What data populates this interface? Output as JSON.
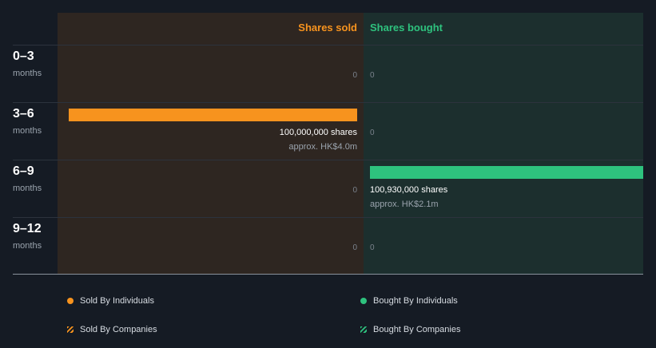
{
  "chart_data": {
    "type": "bar",
    "orientation": "horizontal",
    "columns": [
      "Shares sold",
      "Shares bought"
    ],
    "categories": [
      {
        "range": "0–3",
        "unit": "months"
      },
      {
        "range": "3–6",
        "unit": "months"
      },
      {
        "range": "6–9",
        "unit": "months"
      },
      {
        "range": "9–12",
        "unit": "months"
      }
    ],
    "series": [
      {
        "name": "Shares sold",
        "color": "#f7931e",
        "values": [
          0,
          100000000,
          0,
          0
        ]
      },
      {
        "name": "Shares bought",
        "color": "#2ec27e",
        "values": [
          0,
          0,
          100930000,
          0
        ]
      }
    ],
    "labels": {
      "sold": [
        {
          "zero": "0"
        },
        {
          "shares": "100,000,000 shares",
          "approx": "approx. HK$4.0m"
        },
        {
          "zero": "0"
        },
        {
          "zero": "0"
        }
      ],
      "bought": [
        {
          "zero": "0"
        },
        {
          "zero": "0"
        },
        {
          "shares": "100,930,000 shares",
          "approx": "approx. HK$2.1m"
        },
        {
          "zero": "0"
        }
      ]
    },
    "legend": [
      {
        "label": "Sold By Individuals",
        "color": "#f7931e",
        "style": "dot"
      },
      {
        "label": "Bought By Individuals",
        "color": "#2ec27e",
        "style": "dot"
      },
      {
        "label": "Sold By Companies",
        "color": "#f7931e",
        "style": "hatch"
      },
      {
        "label": "Bought By Companies",
        "color": "#2ec27e",
        "style": "hatch"
      }
    ]
  }
}
